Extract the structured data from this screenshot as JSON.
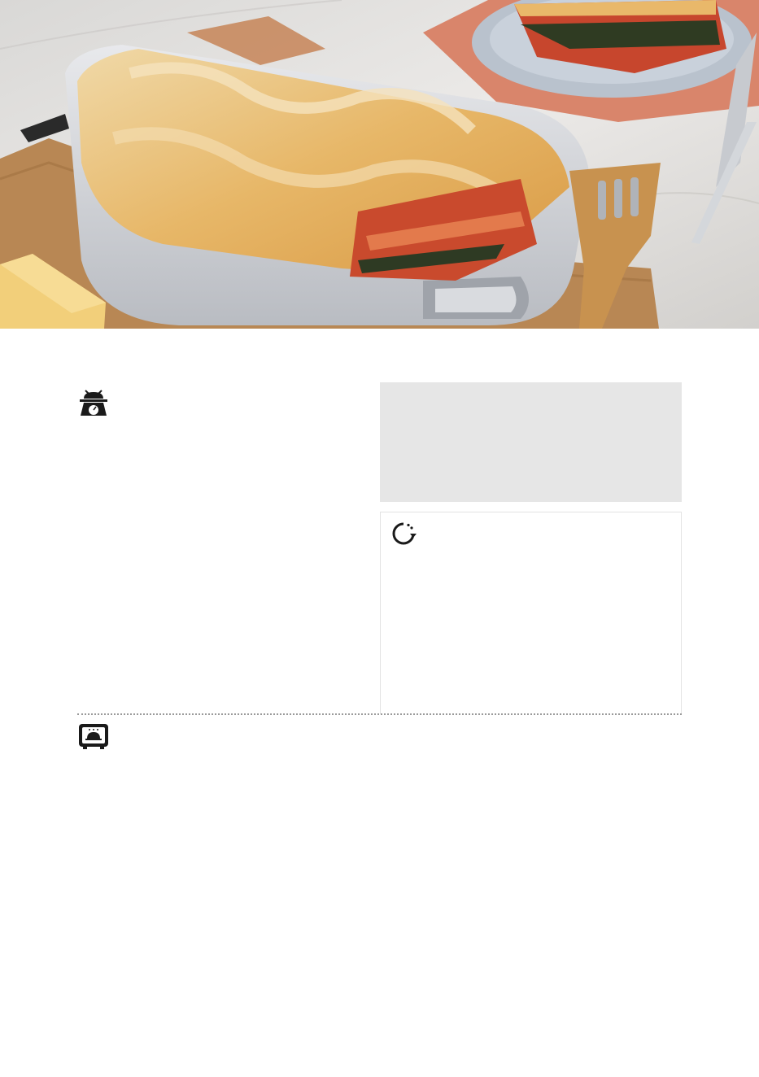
{
  "hero": {
    "image": "lasagne-in-baking-dish-photo"
  },
  "icons": {
    "ingredients": "kitchen-scale-icon",
    "time": "timer-icon",
    "method": "oven-icon"
  },
  "colors": {
    "info_box_bg": "#e6e6e6",
    "divider": "#9a9a9a",
    "icon": "#1a1a1a"
  }
}
